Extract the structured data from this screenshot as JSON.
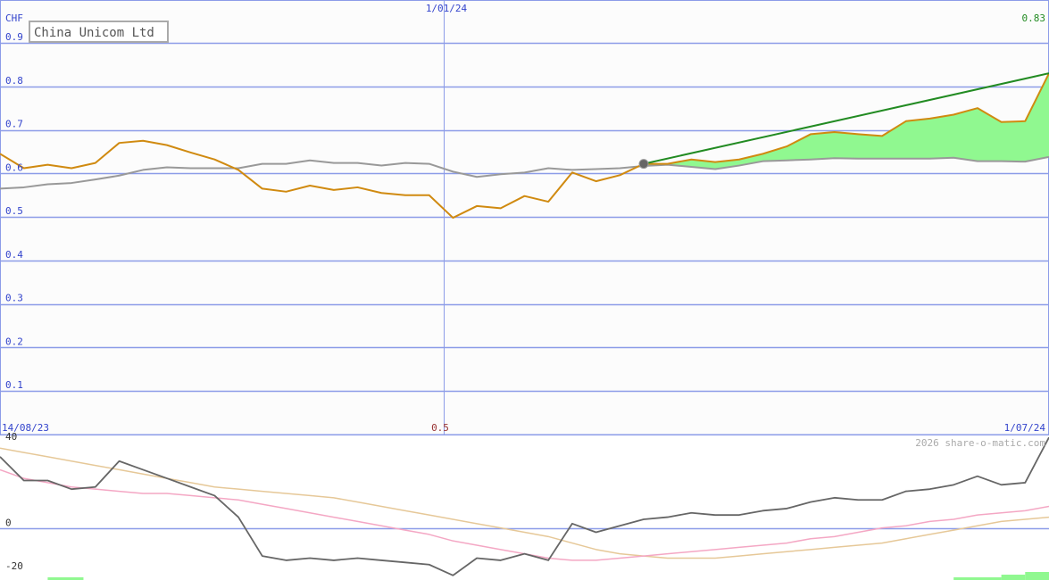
{
  "chart_data": [
    {
      "type": "line",
      "title": "China Unicom Ltd",
      "currency_label": "CHF",
      "last_value_label": "0.83",
      "x_start_label": "14/08/23",
      "x_mid_label": "1/01/24",
      "x_end_label": "1/07/24",
      "ylim": [
        0,
        0.9
      ],
      "yticks": [
        0.1,
        0.2,
        0.3,
        0.4,
        0.5,
        0.6,
        0.7,
        0.8,
        0.9
      ],
      "ytick_labels": [
        "0.1",
        "0.2",
        "0.3",
        "0.4",
        "0.5",
        "0.6",
        "0.7",
        "0.8",
        "0.9"
      ],
      "grid": true,
      "series": [
        {
          "role": "price",
          "color": "#d08a10",
          "values": [
            0.645,
            0.612,
            0.62,
            0.612,
            0.624,
            0.67,
            0.675,
            0.665,
            0.648,
            0.632,
            0.608,
            0.565,
            0.558,
            0.572,
            0.562,
            0.568,
            0.555,
            0.55,
            0.55,
            0.498,
            0.525,
            0.52,
            0.548,
            0.535,
            0.602,
            0.582,
            0.596,
            0.622,
            0.622,
            0.632,
            0.626,
            0.632,
            0.645,
            0.662,
            0.69,
            0.695,
            0.69,
            0.686,
            0.72,
            0.726,
            0.735,
            0.75,
            0.718,
            0.72,
            0.83
          ]
        },
        {
          "role": "comparison",
          "color": "#999999",
          "values": [
            0.565,
            0.568,
            0.575,
            0.578,
            0.586,
            0.595,
            0.608,
            0.614,
            0.612,
            0.612,
            0.612,
            0.622,
            0.622,
            0.63,
            0.624,
            0.624,
            0.618,
            0.624,
            0.622,
            0.604,
            0.592,
            0.598,
            0.602,
            0.612,
            0.608,
            0.61,
            0.612,
            0.617,
            0.62,
            0.615,
            0.61,
            0.618,
            0.628,
            0.63,
            0.632,
            0.635,
            0.634,
            0.634,
            0.634,
            0.634,
            0.636,
            0.628,
            0.628,
            0.627,
            0.638
          ]
        }
      ],
      "fill_color": "#90f890",
      "trend_color": "#228b22",
      "marker_color": "#666666",
      "trend_start_index": 27
    },
    {
      "type": "line",
      "mid_label": "0.5",
      "watermark": "2026 share-o-matic.com",
      "ylim": [
        -20,
        40
      ],
      "yticks": [
        -20,
        0,
        40
      ],
      "ytick_labels": [
        "-20",
        "0",
        "40"
      ],
      "series": [
        {
          "color": "#666666",
          "values": [
            33,
            22,
            22,
            18,
            19,
            31,
            27,
            23,
            19,
            15,
            5,
            -13,
            -15,
            -14,
            -15,
            -14,
            -15,
            -16,
            -17,
            -22,
            -14,
            -15,
            -12,
            -15,
            2,
            -2,
            1,
            4,
            5,
            7,
            6,
            6,
            8,
            9,
            12,
            14,
            13,
            13,
            17,
            18,
            20,
            24,
            20,
            21,
            42
          ]
        },
        {
          "color": "#f4a7c4",
          "values": [
            27,
            23,
            21,
            19,
            18,
            17,
            16,
            16,
            15,
            14,
            13,
            11,
            9,
            7,
            5,
            3,
            1,
            -1,
            -3,
            -6,
            -8,
            -10,
            -12,
            -14,
            -15,
            -15,
            -14,
            -13,
            -12,
            -11,
            -10,
            -9,
            -8,
            -7,
            -5,
            -4,
            -2,
            0,
            1,
            3,
            4,
            6,
            7,
            8,
            10
          ]
        },
        {
          "color": "#e6c898",
          "values": [
            37,
            35,
            33,
            31,
            29,
            27,
            25,
            23,
            21,
            19,
            18,
            17,
            16,
            15,
            14,
            12,
            10,
            8,
            6,
            4,
            2,
            0,
            -2,
            -4,
            -7,
            -10,
            -12,
            -13,
            -14,
            -14,
            -14,
            -13,
            -12,
            -11,
            -10,
            -9,
            -8,
            -7,
            -5,
            -3,
            -1,
            1,
            3,
            4,
            5
          ]
        }
      ],
      "volume_bars": [
        {
          "from": 2,
          "to": 3.5,
          "value": 1
        },
        {
          "from": 40,
          "to": 42,
          "value": 1
        },
        {
          "from": 42,
          "to": 43,
          "value": 2
        },
        {
          "from": 43,
          "to": 44,
          "value": 3
        }
      ],
      "volume_color": "#90f890"
    }
  ]
}
